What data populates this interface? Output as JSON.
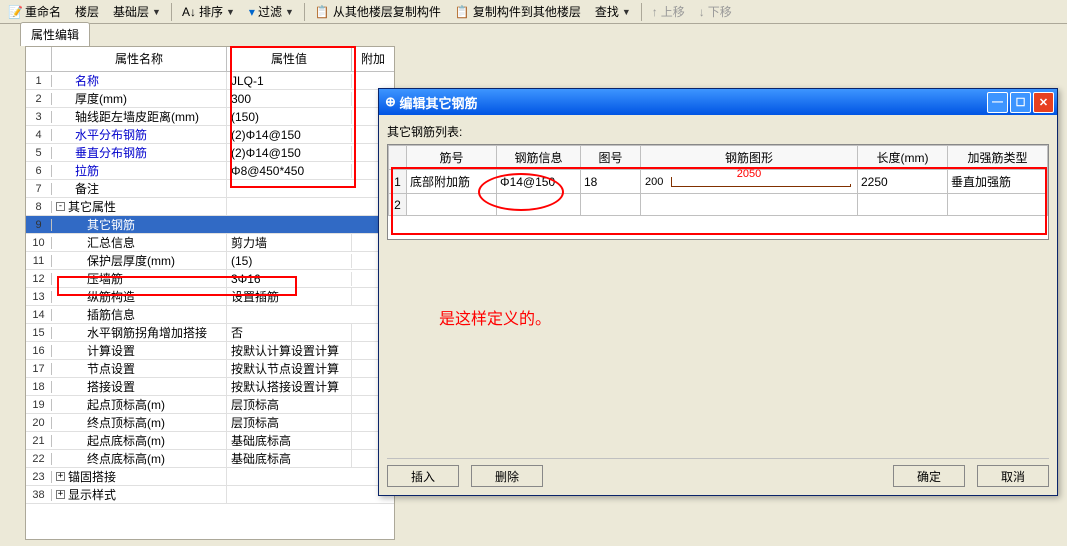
{
  "toolbar": {
    "rename": "重命名",
    "floor": "楼层",
    "basefloor": "基础层",
    "sort": "排序",
    "filter": "过滤",
    "copyfrom": "从其他楼层复制构件",
    "copyto": "复制构件到其他楼层",
    "find": "查找",
    "moveup": "上移",
    "movedown": "下移"
  },
  "tab": {
    "label": "属性编辑"
  },
  "header": {
    "name": "属性名称",
    "value": "属性值",
    "extra": "附加"
  },
  "rows": [
    {
      "n": "1",
      "name": "名称",
      "val": "JLQ-1",
      "link": true,
      "ind": 1
    },
    {
      "n": "2",
      "name": "厚度(mm)",
      "val": "300",
      "ind": 1
    },
    {
      "n": "3",
      "name": "轴线距左墙皮距离(mm)",
      "val": "(150)",
      "ind": 1
    },
    {
      "n": "4",
      "name": "水平分布钢筋",
      "val": "(2)Φ14@150",
      "link": true,
      "ind": 1
    },
    {
      "n": "5",
      "name": "垂直分布钢筋",
      "val": "(2)Φ14@150",
      "link": true,
      "ind": 1
    },
    {
      "n": "6",
      "name": "拉筋",
      "val": "Φ8@450*450",
      "link": true,
      "ind": 1
    },
    {
      "n": "7",
      "name": "备注",
      "val": "",
      "ind": 1
    },
    {
      "n": "8",
      "name": "其它属性",
      "val": "",
      "tree": "-",
      "ind": 0
    },
    {
      "n": "9",
      "name": "其它钢筋",
      "val": "",
      "ind": 2,
      "sel": true
    },
    {
      "n": "10",
      "name": "汇总信息",
      "val": "剪力墙",
      "ind": 2
    },
    {
      "n": "11",
      "name": "保护层厚度(mm)",
      "val": "(15)",
      "ind": 2
    },
    {
      "n": "12",
      "name": "压墙筋",
      "val": "3Φ16",
      "ind": 2
    },
    {
      "n": "13",
      "name": "纵筋构造",
      "val": "设置插筋",
      "ind": 2
    },
    {
      "n": "14",
      "name": "插筋信息",
      "val": "",
      "ind": 2
    },
    {
      "n": "15",
      "name": "水平钢筋拐角增加搭接",
      "val": "否",
      "ind": 2
    },
    {
      "n": "16",
      "name": "计算设置",
      "val": "按默认计算设置计算",
      "ind": 2
    },
    {
      "n": "17",
      "name": "节点设置",
      "val": "按默认节点设置计算",
      "ind": 2
    },
    {
      "n": "18",
      "name": "搭接设置",
      "val": "按默认搭接设置计算",
      "ind": 2
    },
    {
      "n": "19",
      "name": "起点顶标高(m)",
      "val": "层顶标高",
      "ind": 2
    },
    {
      "n": "20",
      "name": "终点顶标高(m)",
      "val": "层顶标高",
      "ind": 2
    },
    {
      "n": "21",
      "name": "起点底标高(m)",
      "val": "基础底标高",
      "ind": 2
    },
    {
      "n": "22",
      "name": "终点底标高(m)",
      "val": "基础底标高",
      "ind": 2
    },
    {
      "n": "23",
      "name": "锚固搭接",
      "val": "",
      "tree": "+",
      "ind": 0
    },
    {
      "n": "38",
      "name": "显示样式",
      "val": "",
      "tree": "+",
      "ind": 0
    }
  ],
  "dialog": {
    "title": "编辑其它钢筋",
    "listlabel": "其它钢筋列表:",
    "cols": [
      "筋号",
      "钢筋信息",
      "图号",
      "钢筋图形",
      "长度(mm)",
      "加强筋类型"
    ],
    "r1": {
      "n": "1",
      "a": "底部附加筋",
      "b": "Φ14@150",
      "c": "18",
      "dL": "200",
      "dT": "2050",
      "e": "2250",
      "f": "垂直加强筋"
    },
    "r2": {
      "n": "2"
    },
    "insert": "插入",
    "delete": "删除",
    "ok": "确定",
    "cancel": "取消"
  },
  "note": "是这样定义的。"
}
